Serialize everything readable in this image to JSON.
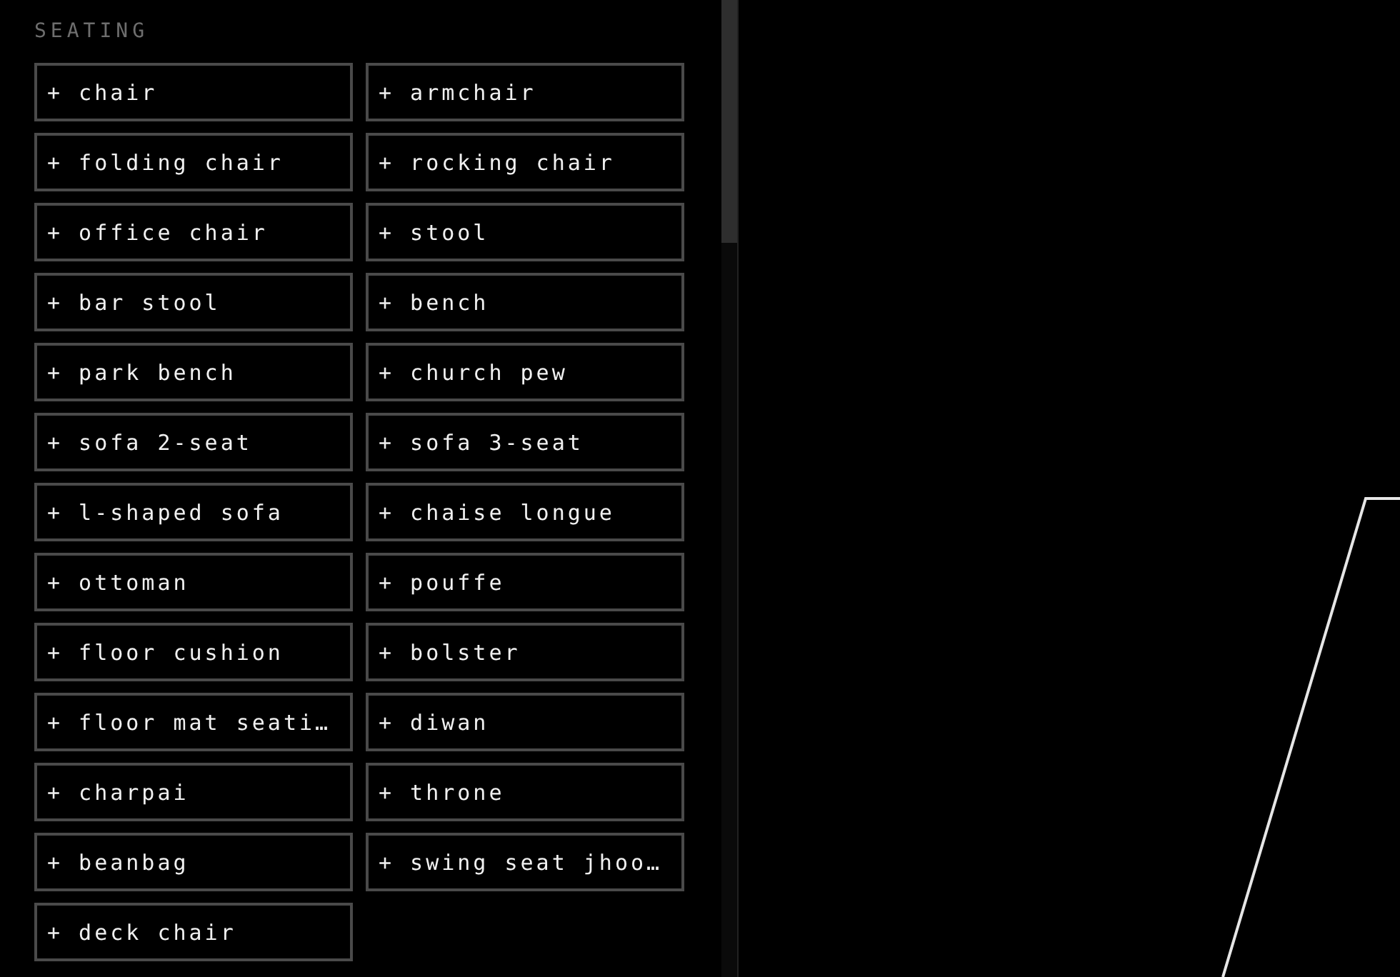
{
  "panel": {
    "heading": "SEATING",
    "items": [
      {
        "label": "+ chair"
      },
      {
        "label": "+ armchair"
      },
      {
        "label": "+ folding chair"
      },
      {
        "label": "+ rocking chair"
      },
      {
        "label": "+ office chair"
      },
      {
        "label": "+ stool"
      },
      {
        "label": "+ bar stool"
      },
      {
        "label": "+ bench"
      },
      {
        "label": "+ park bench"
      },
      {
        "label": "+ church pew"
      },
      {
        "label": "+ sofa 2-seat"
      },
      {
        "label": "+ sofa 3-seat"
      },
      {
        "label": "+ l-shaped sofa"
      },
      {
        "label": "+ chaise longue"
      },
      {
        "label": "+ ottoman"
      },
      {
        "label": "+ pouffe"
      },
      {
        "label": "+ floor cushion"
      },
      {
        "label": "+ bolster"
      },
      {
        "label": "+ floor mat seati…"
      },
      {
        "label": "+ diwan"
      },
      {
        "label": "+ charpai"
      },
      {
        "label": "+ throne"
      },
      {
        "label": "+ beanbag"
      },
      {
        "label": "+ swing seat jhoo…"
      },
      {
        "label": "+ deck chair"
      }
    ]
  }
}
